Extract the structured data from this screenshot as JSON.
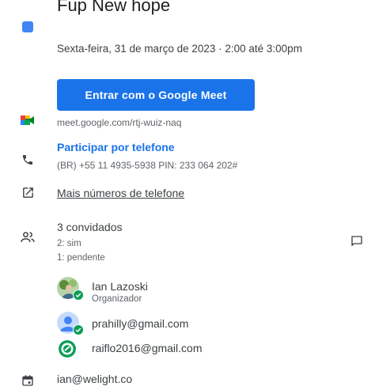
{
  "event": {
    "title": "Fup New hope",
    "date_time": "Sexta-feira, 31 de março de 2023  ·  2:00 até 3:00pm",
    "color": "#4285f4"
  },
  "meet": {
    "button_label": "Entrar com o Google Meet",
    "link": "meet.google.com/rtj-wuiz-naq",
    "icon": "google-meet-icon"
  },
  "phone": {
    "join_label": "Participar por telefone",
    "details": "(BR) +55 11 4935-5938 PIN: 233 064 202#",
    "icon": "phone-icon"
  },
  "more_phones": {
    "label": "Mais números de telefone",
    "icon": "open-external-icon"
  },
  "guests": {
    "count_label": "3 convidados",
    "yes_label": "2: sim",
    "pending_label": "1: pendente",
    "list": [
      {
        "name": "Ian Lazoski",
        "role": "Organizador"
      },
      {
        "name": "prahilly@gmail.com"
      },
      {
        "name": "raiflo2016@gmail.com"
      }
    ],
    "icon": "people-icon",
    "email_guests_icon": "message-icon"
  },
  "organizer_calendar": {
    "email": "ian@welight.co",
    "icon": "calendar-icon"
  },
  "colors": {
    "accent": "#1a73e8",
    "accepted": "#0f9d58"
  }
}
